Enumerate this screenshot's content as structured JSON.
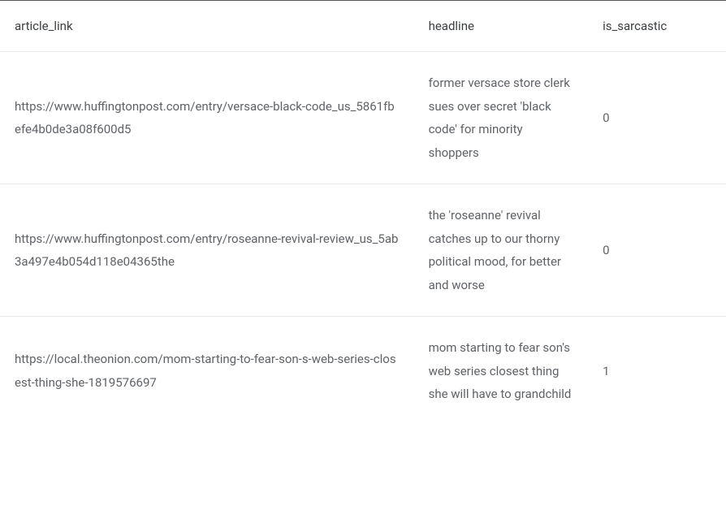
{
  "table": {
    "columns": [
      {
        "label": "article_link"
      },
      {
        "label": "headline"
      },
      {
        "label": "is_sarcastic"
      }
    ],
    "rows": [
      {
        "article_link": "https://www.huffingtonpost.com/entry/versace-black-code_us_5861fbefe4b0de3a08f600d5",
        "headline": "former versace store clerk sues over secret 'black code' for minority shoppers",
        "is_sarcastic": "0"
      },
      {
        "article_link": "https://www.huffingtonpost.com/entry/roseanne-revival-review_us_5ab3a497e4b054d118e04365the",
        "headline": "the 'roseanne' revival catches up to our thorny political mood, for better and worse",
        "is_sarcastic": "0"
      },
      {
        "article_link": "https://local.theonion.com/mom-starting-to-fear-son-s-web-series-closest-thing-she-1819576697",
        "headline": "mom starting to fear son's web series closest thing she will have to grandchild",
        "is_sarcastic": "1"
      }
    ]
  }
}
